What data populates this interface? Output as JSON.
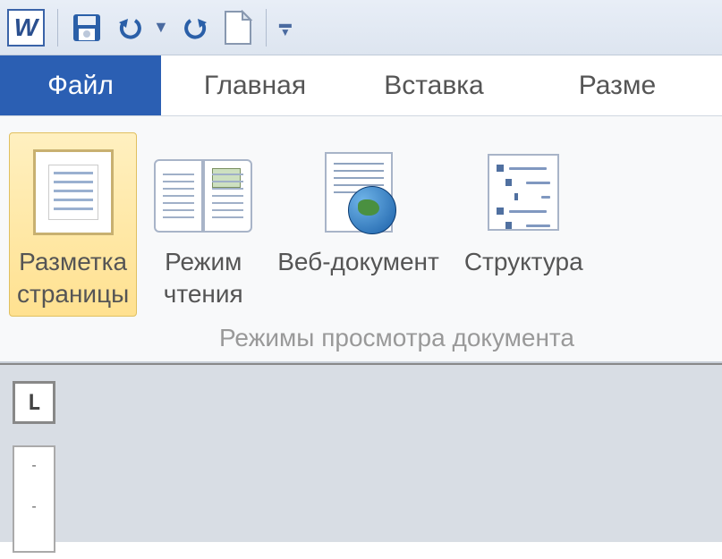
{
  "qat": {
    "word_glyph": "W",
    "items": [
      "save",
      "undo",
      "redo",
      "new-document",
      "customize"
    ]
  },
  "tabs": {
    "file": "Файл",
    "home": "Главная",
    "insert": "Вставка",
    "page_layout": "Разме"
  },
  "ribbon": {
    "group_label": "Режимы просмотра документа",
    "buttons": {
      "page_layout": "Разметка\nстраницы",
      "reading": "Режим\nчтения",
      "web": "Веб-документ",
      "outline": "Структура"
    },
    "active": "page_layout"
  },
  "ruler": {
    "tab_stop_glyph": "L",
    "ticks": [
      "-",
      "-"
    ]
  }
}
